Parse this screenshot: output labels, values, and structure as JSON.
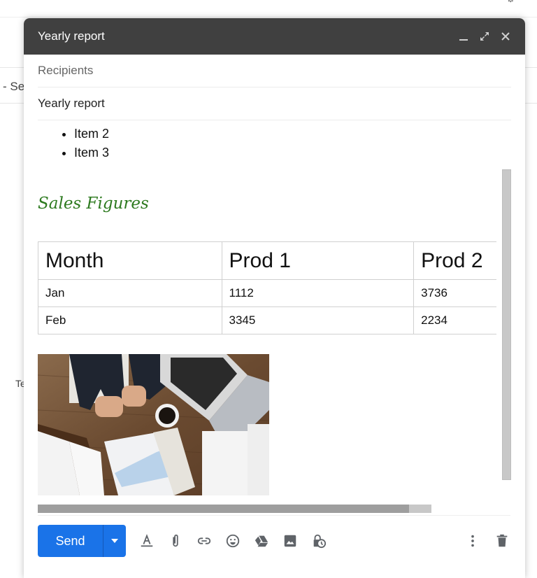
{
  "background": {
    "partial_text_left": "- Se",
    "partial_text_left_lower": "Te"
  },
  "compose": {
    "title": "Yearly report",
    "header_icons": [
      "minimize-icon",
      "expand-icon",
      "close-icon"
    ],
    "recipients_placeholder": "Recipients",
    "subject": "Yearly report",
    "body": {
      "bullets": [
        "Item 2",
        "Item 3"
      ],
      "heading": "Sales Figures",
      "heading_color": "#2d7a1f",
      "table": {
        "headers": [
          "Month",
          "Prod 1",
          "Prod 2"
        ],
        "rows": [
          [
            "Jan",
            "1112",
            "3736"
          ],
          [
            "Feb",
            "3345",
            "2234"
          ]
        ]
      },
      "image_description": "Business desk with laptop, coffee, charts and calendar"
    },
    "toolbar": {
      "send_label": "Send",
      "send_color": "#1a73e8",
      "icons": [
        "format-text-icon",
        "attach-icon",
        "link-icon",
        "emoji-icon",
        "drive-icon",
        "photo-icon",
        "confidential-mode-icon"
      ],
      "right_icons": [
        "more-options-icon",
        "discard-icon"
      ]
    }
  }
}
